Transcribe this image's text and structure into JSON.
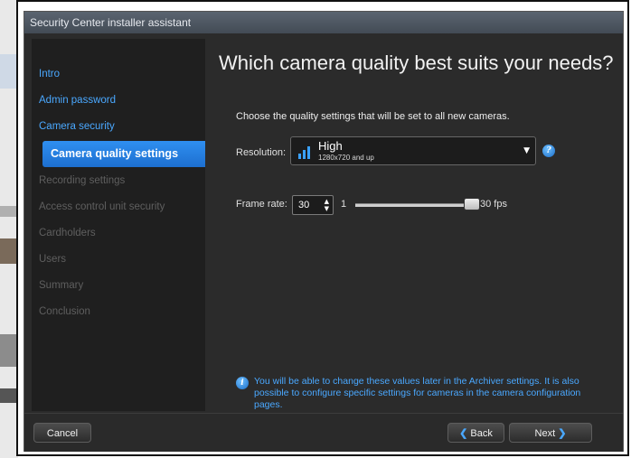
{
  "window": {
    "title": "Security Center installer assistant"
  },
  "nav": {
    "items": [
      {
        "label": "Intro",
        "state": "done"
      },
      {
        "label": "Admin password",
        "state": "done"
      },
      {
        "label": "Camera security",
        "state": "done"
      },
      {
        "label": "Camera quality settings",
        "state": "active"
      },
      {
        "label": "Recording settings",
        "state": "todo"
      },
      {
        "label": "Access control unit security",
        "state": "todo"
      },
      {
        "label": "Cardholders",
        "state": "todo"
      },
      {
        "label": "Users",
        "state": "todo"
      },
      {
        "label": "Summary",
        "state": "todo"
      },
      {
        "label": "Conclusion",
        "state": "todo"
      }
    ]
  },
  "main": {
    "heading": "Which camera quality best suits your needs?",
    "description": "Choose the quality settings that will be set to all new cameras.",
    "resolution": {
      "label": "Resolution:",
      "value": "High",
      "subtext": "1280x720 and up",
      "help": "?"
    },
    "frame_rate": {
      "label": "Frame rate:",
      "value": "30",
      "min": "1",
      "max": "30 fps",
      "level": 1.0
    },
    "info": "You will be able to change these values later in the Archiver settings. It is also possible to configure specific settings for cameras in the camera configuration pages."
  },
  "footer": {
    "cancel": "Cancel",
    "back": "Back",
    "next": "Next"
  },
  "colors": {
    "accent": "#2f8ff0",
    "link": "#4aa8ff",
    "panel": "#2b2b2b"
  }
}
